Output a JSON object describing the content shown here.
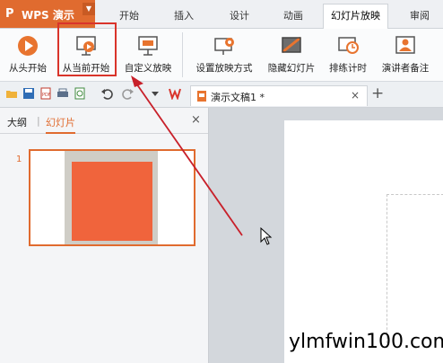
{
  "app": {
    "logo": "P",
    "name": "WPS 演示",
    "menu_arrow": "▼"
  },
  "tabs": [
    {
      "label": "开始"
    },
    {
      "label": "插入"
    },
    {
      "label": "设计"
    },
    {
      "label": "动画"
    },
    {
      "label": "幻灯片放映",
      "active": true
    },
    {
      "label": "审阅"
    }
  ],
  "ribbon": {
    "buttons": [
      {
        "label": "从头开始",
        "icon": "play-from-start-icon"
      },
      {
        "label": "从当前开始",
        "icon": "play-from-current-icon",
        "highlighted": true
      },
      {
        "label": "自定义放映",
        "icon": "custom-show-icon"
      },
      {
        "label": "设置放映方式",
        "icon": "setup-show-icon"
      },
      {
        "label": "隐藏幻灯片",
        "icon": "hide-slide-icon"
      },
      {
        "label": "排练计时",
        "icon": "rehearse-timing-icon"
      },
      {
        "label": "演讲者备注",
        "icon": "speaker-notes-icon"
      }
    ]
  },
  "document": {
    "tab_title": "演示文稿1 *",
    "close": "×",
    "add": "+"
  },
  "left_panel": {
    "tabs": [
      {
        "label": "大纲"
      },
      {
        "label": "幻灯片",
        "active": true
      }
    ],
    "close": "×",
    "slides": [
      {
        "number": "1"
      }
    ]
  },
  "watermark": "ylmfwin100.com",
  "colors": {
    "brand": "#e06b2f",
    "highlight_box": "#d9342b",
    "arrow": "#c8202a",
    "slide_shape": "#f0643c",
    "slide_gray": "#cfcdc6"
  }
}
